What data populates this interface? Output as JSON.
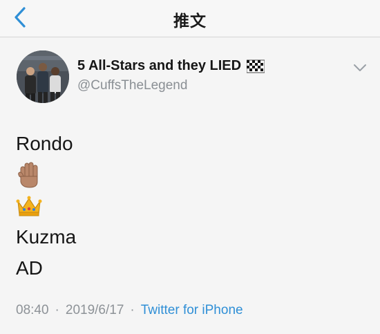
{
  "header": {
    "title": "推文"
  },
  "tweet": {
    "display_name": "5 All-Stars and they LIED",
    "handle": "@CuffsTheLegend",
    "lines": [
      {
        "type": "text",
        "text": "Rondo"
      },
      {
        "type": "emoji",
        "icon": "raised-hand-icon"
      },
      {
        "type": "emoji",
        "icon": "crown-icon"
      },
      {
        "type": "text",
        "text": "Kuzma"
      },
      {
        "type": "text",
        "text": "AD"
      }
    ],
    "time": "08:40",
    "separator": "·",
    "date": "2019/6/17",
    "source": "Twitter for iPhone"
  },
  "colors": {
    "accent": "#2f8fd6",
    "secondary_text": "#8a8f94"
  }
}
